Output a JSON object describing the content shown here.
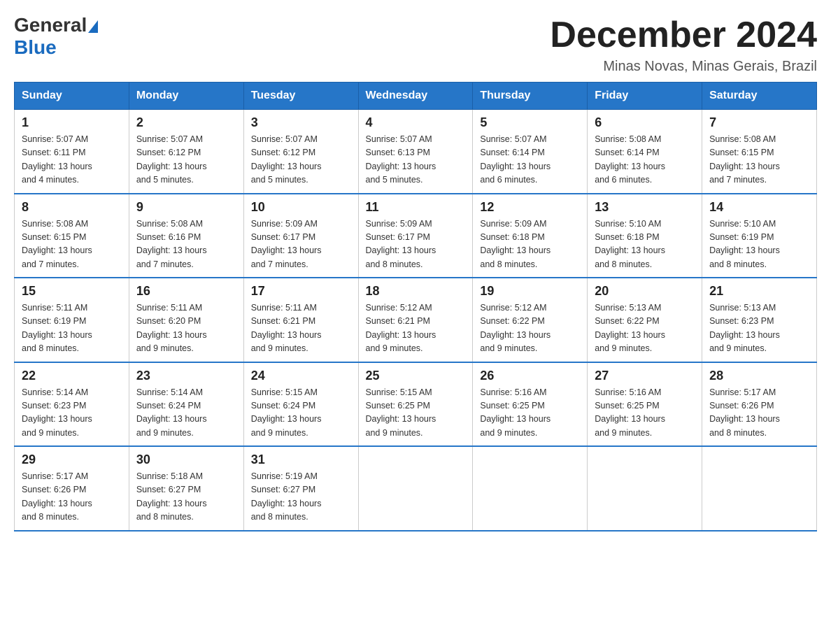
{
  "header": {
    "logo_general": "General",
    "logo_blue": "Blue",
    "title": "December 2024",
    "subtitle": "Minas Novas, Minas Gerais, Brazil"
  },
  "columns": [
    "Sunday",
    "Monday",
    "Tuesday",
    "Wednesday",
    "Thursday",
    "Friday",
    "Saturday"
  ],
  "weeks": [
    [
      {
        "day": "1",
        "info": "Sunrise: 5:07 AM\nSunset: 6:11 PM\nDaylight: 13 hours\nand 4 minutes."
      },
      {
        "day": "2",
        "info": "Sunrise: 5:07 AM\nSunset: 6:12 PM\nDaylight: 13 hours\nand 5 minutes."
      },
      {
        "day": "3",
        "info": "Sunrise: 5:07 AM\nSunset: 6:12 PM\nDaylight: 13 hours\nand 5 minutes."
      },
      {
        "day": "4",
        "info": "Sunrise: 5:07 AM\nSunset: 6:13 PM\nDaylight: 13 hours\nand 5 minutes."
      },
      {
        "day": "5",
        "info": "Sunrise: 5:07 AM\nSunset: 6:14 PM\nDaylight: 13 hours\nand 6 minutes."
      },
      {
        "day": "6",
        "info": "Sunrise: 5:08 AM\nSunset: 6:14 PM\nDaylight: 13 hours\nand 6 minutes."
      },
      {
        "day": "7",
        "info": "Sunrise: 5:08 AM\nSunset: 6:15 PM\nDaylight: 13 hours\nand 7 minutes."
      }
    ],
    [
      {
        "day": "8",
        "info": "Sunrise: 5:08 AM\nSunset: 6:15 PM\nDaylight: 13 hours\nand 7 minutes."
      },
      {
        "day": "9",
        "info": "Sunrise: 5:08 AM\nSunset: 6:16 PM\nDaylight: 13 hours\nand 7 minutes."
      },
      {
        "day": "10",
        "info": "Sunrise: 5:09 AM\nSunset: 6:17 PM\nDaylight: 13 hours\nand 7 minutes."
      },
      {
        "day": "11",
        "info": "Sunrise: 5:09 AM\nSunset: 6:17 PM\nDaylight: 13 hours\nand 8 minutes."
      },
      {
        "day": "12",
        "info": "Sunrise: 5:09 AM\nSunset: 6:18 PM\nDaylight: 13 hours\nand 8 minutes."
      },
      {
        "day": "13",
        "info": "Sunrise: 5:10 AM\nSunset: 6:18 PM\nDaylight: 13 hours\nand 8 minutes."
      },
      {
        "day": "14",
        "info": "Sunrise: 5:10 AM\nSunset: 6:19 PM\nDaylight: 13 hours\nand 8 minutes."
      }
    ],
    [
      {
        "day": "15",
        "info": "Sunrise: 5:11 AM\nSunset: 6:19 PM\nDaylight: 13 hours\nand 8 minutes."
      },
      {
        "day": "16",
        "info": "Sunrise: 5:11 AM\nSunset: 6:20 PM\nDaylight: 13 hours\nand 9 minutes."
      },
      {
        "day": "17",
        "info": "Sunrise: 5:11 AM\nSunset: 6:21 PM\nDaylight: 13 hours\nand 9 minutes."
      },
      {
        "day": "18",
        "info": "Sunrise: 5:12 AM\nSunset: 6:21 PM\nDaylight: 13 hours\nand 9 minutes."
      },
      {
        "day": "19",
        "info": "Sunrise: 5:12 AM\nSunset: 6:22 PM\nDaylight: 13 hours\nand 9 minutes."
      },
      {
        "day": "20",
        "info": "Sunrise: 5:13 AM\nSunset: 6:22 PM\nDaylight: 13 hours\nand 9 minutes."
      },
      {
        "day": "21",
        "info": "Sunrise: 5:13 AM\nSunset: 6:23 PM\nDaylight: 13 hours\nand 9 minutes."
      }
    ],
    [
      {
        "day": "22",
        "info": "Sunrise: 5:14 AM\nSunset: 6:23 PM\nDaylight: 13 hours\nand 9 minutes."
      },
      {
        "day": "23",
        "info": "Sunrise: 5:14 AM\nSunset: 6:24 PM\nDaylight: 13 hours\nand 9 minutes."
      },
      {
        "day": "24",
        "info": "Sunrise: 5:15 AM\nSunset: 6:24 PM\nDaylight: 13 hours\nand 9 minutes."
      },
      {
        "day": "25",
        "info": "Sunrise: 5:15 AM\nSunset: 6:25 PM\nDaylight: 13 hours\nand 9 minutes."
      },
      {
        "day": "26",
        "info": "Sunrise: 5:16 AM\nSunset: 6:25 PM\nDaylight: 13 hours\nand 9 minutes."
      },
      {
        "day": "27",
        "info": "Sunrise: 5:16 AM\nSunset: 6:25 PM\nDaylight: 13 hours\nand 9 minutes."
      },
      {
        "day": "28",
        "info": "Sunrise: 5:17 AM\nSunset: 6:26 PM\nDaylight: 13 hours\nand 8 minutes."
      }
    ],
    [
      {
        "day": "29",
        "info": "Sunrise: 5:17 AM\nSunset: 6:26 PM\nDaylight: 13 hours\nand 8 minutes."
      },
      {
        "day": "30",
        "info": "Sunrise: 5:18 AM\nSunset: 6:27 PM\nDaylight: 13 hours\nand 8 minutes."
      },
      {
        "day": "31",
        "info": "Sunrise: 5:19 AM\nSunset: 6:27 PM\nDaylight: 13 hours\nand 8 minutes."
      },
      {
        "day": "",
        "info": ""
      },
      {
        "day": "",
        "info": ""
      },
      {
        "day": "",
        "info": ""
      },
      {
        "day": "",
        "info": ""
      }
    ]
  ]
}
